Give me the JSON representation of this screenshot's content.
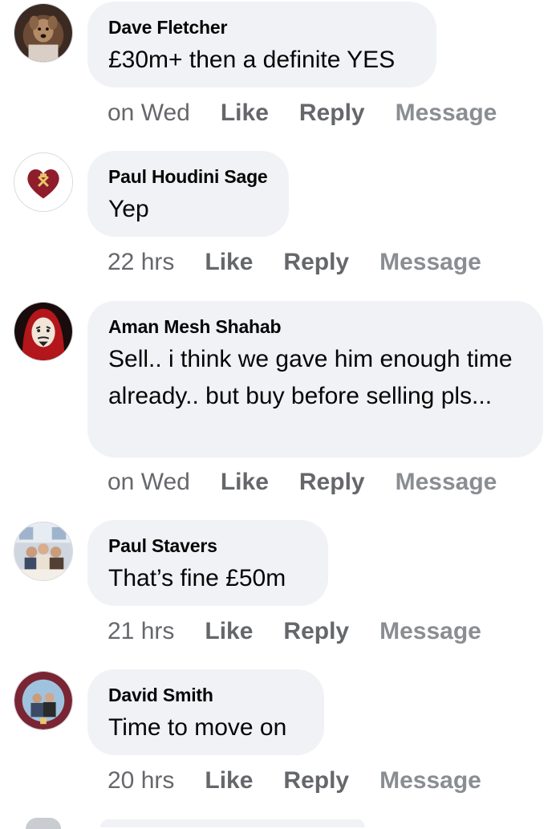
{
  "comments": [
    {
      "author": "Dave Fletcher",
      "text": "£30m+ then a definite YES",
      "time": "on Wed",
      "like": "Like",
      "reply": "Reply",
      "message": "Message"
    },
    {
      "author": "Paul Houdini Sage",
      "text": "Yep",
      "time": "22 hrs",
      "like": "Like",
      "reply": "Reply",
      "message": "Message"
    },
    {
      "author": "Aman Mesh Shahab",
      "text": "Sell.. i think we gave him enough time already.. but buy before selling pls...",
      "time": "on Wed",
      "like": "Like",
      "reply": "Reply",
      "message": "Message"
    },
    {
      "author": "Paul Stavers",
      "text": "That’s fine £50m",
      "time": "21 hrs",
      "like": "Like",
      "reply": "Reply",
      "message": "Message"
    },
    {
      "author": "David Smith",
      "text": "Time to move on",
      "time": "20 hrs",
      "like": "Like",
      "reply": "Reply",
      "message": "Message"
    }
  ],
  "icons": {
    "avatars": [
      "dog-photo-avatar",
      "heart-crest-avatar",
      "mask-avatar",
      "group-photo-avatar",
      "club-badge-photo-avatar"
    ]
  },
  "colors": {
    "bubble": "#f0f2f5",
    "meta_text": "#65676b",
    "body_text": "#050505"
  }
}
